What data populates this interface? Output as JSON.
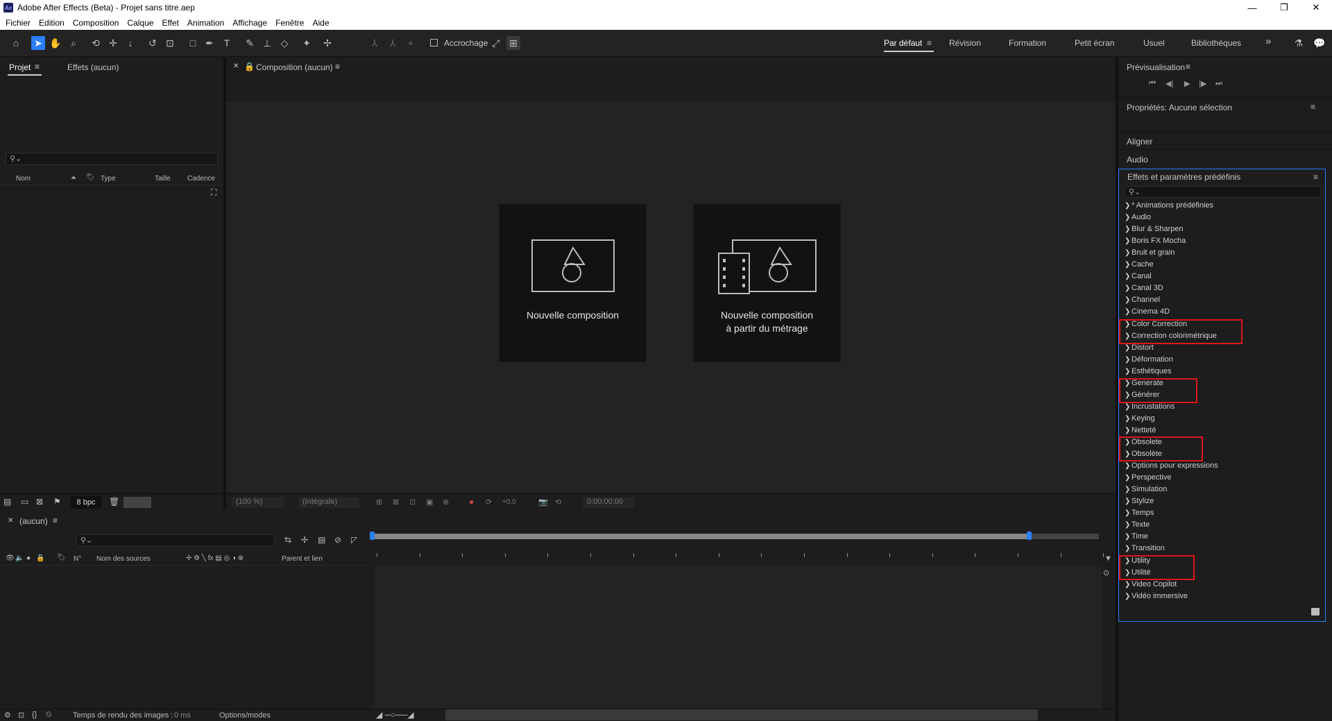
{
  "window": {
    "title": "Adobe After Effects (Beta) - Projet sans titre.aep",
    "logo_text": "Ae",
    "controls": {
      "minimize": "—",
      "restore": "❐",
      "close": "✕"
    }
  },
  "menu": [
    "Fichier",
    "Edition",
    "Composition",
    "Calque",
    "Effet",
    "Animation",
    "Affichage",
    "Fenêtre",
    "Aide"
  ],
  "toolbar": {
    "snapping_label": "Accrochage",
    "workspaces": [
      "Par défaut",
      "Révision",
      "Formation",
      "Petit écran",
      "Usuel",
      "Bibliothèques"
    ],
    "active_workspace": "Par défaut",
    "more_label": "»"
  },
  "project_panel": {
    "tabs": [
      "Projet",
      "Effets (aucun)"
    ],
    "active_tab": "Projet",
    "search_placeholder": "",
    "columns": [
      "Nom",
      "Type",
      "Taille",
      "Cadence"
    ],
    "bit_depth": "8 bpc"
  },
  "composition_panel": {
    "tab_label": "Composition (aucun)",
    "cards": [
      {
        "label_line1": "Nouvelle composition",
        "label_line2": ""
      },
      {
        "label_line1": "Nouvelle composition",
        "label_line2": "à partir du métrage"
      }
    ],
    "footer": {
      "zoom": "(100 %)",
      "resolution": "(Intégrale)",
      "exposure": "+0,0",
      "timecode": "0:00:00:00"
    }
  },
  "timeline": {
    "tab_label": "(aucun)",
    "columns": [
      "N°",
      "Nom des sources",
      "Parent et lien"
    ],
    "render_time_label": "Temps de rendu des images :",
    "render_time_value": "0 ms",
    "options_label": "Options/modes"
  },
  "right_panels": {
    "preview_title": "Prévisualisation",
    "properties_title": "Propriétés: Aucune sélection",
    "align_title": "Aligner",
    "audio_title": "Audio",
    "effects_title": "Effets et paramètres prédéfinis",
    "effects_search_placeholder": "",
    "effects": [
      "* Animations prédéfinies",
      "Audio",
      "Blur & Sharpen",
      "Boris FX Mocha",
      "Bruit et grain",
      "Cache",
      "Canal",
      "Canal 3D",
      "Channel",
      "Cinema 4D",
      "Color Correction",
      "Correction colorimétrique",
      "Distort",
      "Déformation",
      "Esthétiques",
      "Generate",
      "Générer",
      "Incrustations",
      "Keying",
      "Netteté",
      "Obsolete",
      "Obsolète",
      "Options pour expressions",
      "Perspective",
      "Simulation",
      "Stylize",
      "Temps",
      "Texte",
      "Time",
      "Transition",
      "Utility",
      "Utilité",
      "Video Copilot",
      "Vidéo immersive"
    ],
    "highlighted_pairs": [
      [
        "Color Correction",
        "Correction colorimétrique"
      ],
      [
        "Generate",
        "Générer"
      ],
      [
        "Obsolete",
        "Obsolète"
      ],
      [
        "Utility",
        "Utilité"
      ]
    ],
    "highlight_color": "#e0161b"
  },
  "colors": {
    "accent": "#2b7fff",
    "panel_bg": "#1d1d1d",
    "viewer_bg": "#232323",
    "card_bg": "#121212"
  }
}
